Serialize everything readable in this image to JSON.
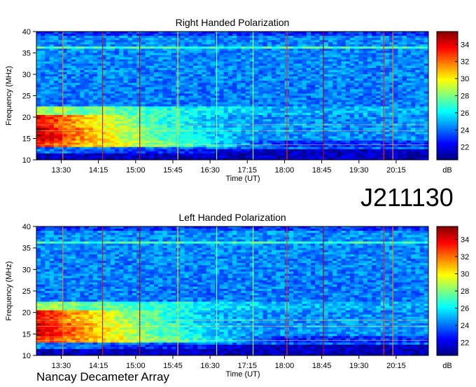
{
  "chart_data": [
    {
      "type": "heatmap",
      "title": "Right Handed Polarization",
      "xlabel": "Time (UT)",
      "ylabel": "Frequency (MHz)",
      "x_ticks": [
        "13:30",
        "14:15",
        "15:00",
        "15:45",
        "16:30",
        "17:15",
        "18:00",
        "18:45",
        "19:30",
        "20:15"
      ],
      "x_tick_minutes": [
        810,
        855,
        900,
        945,
        990,
        1035,
        1080,
        1125,
        1170,
        1215
      ],
      "x_range_minutes": [
        780,
        1254
      ],
      "y_ticks": [
        10,
        15,
        20,
        25,
        30,
        35,
        40
      ],
      "ylim": [
        10,
        40
      ],
      "colorbar": {
        "label": "dB",
        "ticks": [
          22,
          24,
          26,
          28,
          30,
          32,
          34
        ],
        "range": [
          20.5,
          35.5
        ]
      },
      "colors": {
        "low": "#00008b",
        "mid": "#00c8ff",
        "high": "#8b0000"
      }
    },
    {
      "type": "heatmap",
      "title": "Left Handed Polarization",
      "xlabel": "Time (UT)",
      "ylabel": "Frequency (MHz)",
      "x_ticks": [
        "13:30",
        "14:15",
        "15:00",
        "15:45",
        "16:30",
        "17:15",
        "18:00",
        "18:45",
        "19:30",
        "20:15"
      ],
      "x_tick_minutes": [
        810,
        855,
        900,
        945,
        990,
        1035,
        1080,
        1125,
        1170,
        1215
      ],
      "x_range_minutes": [
        780,
        1254
      ],
      "y_ticks": [
        10,
        15,
        20,
        25,
        30,
        35,
        40
      ],
      "ylim": [
        10,
        40
      ],
      "colorbar": {
        "label": "dB",
        "ticks": [
          22,
          24,
          26,
          28,
          30,
          32,
          34
        ],
        "range": [
          20.5,
          35.5
        ]
      },
      "colors": {
        "low": "#00008b",
        "mid": "#00c8ff",
        "high": "#8b0000"
      }
    }
  ],
  "date_label": "J211130",
  "footer": "Nancay Decameter Array"
}
